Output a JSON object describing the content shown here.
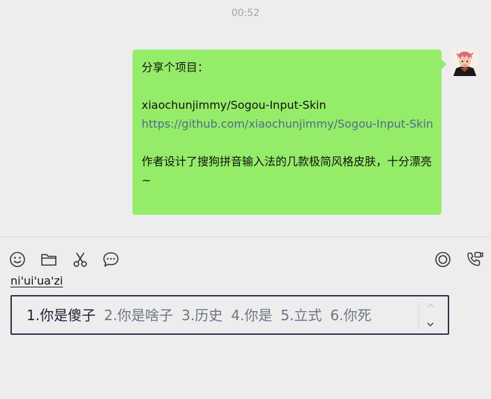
{
  "chat": {
    "timestamp": "00:52",
    "message": {
      "line1": "分享个项目：",
      "line2": "xiaochunjimmy/Sogou-Input-Skin",
      "link": "https://github.com/xiaochunjimmy/Sogou-Input-Skin",
      "line3": "作者设计了搜狗拼音输入法的几款极简风格皮肤，十分漂亮~"
    }
  },
  "toolbar": {
    "icons": [
      "emoji-icon",
      "folder-icon",
      "scissors-icon",
      "chat-bubble-icon",
      "record-icon",
      "call-icon"
    ]
  },
  "ime": {
    "pinyin": "ni'ui'ua'zi",
    "candidates": [
      "1.你是傻子",
      "2.你是啥子",
      "3.历史",
      "4.你是",
      "5.立式",
      "6.你死"
    ],
    "selected_index": 0
  },
  "colors": {
    "bubble": "#95ec69",
    "link": "#4e6b8f",
    "candidate_border": "#2f3048"
  }
}
